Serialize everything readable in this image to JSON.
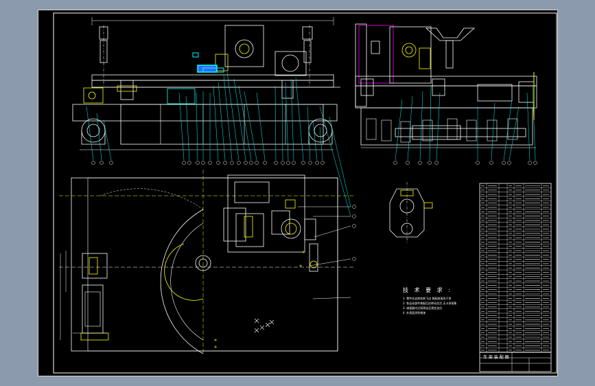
{
  "drawing": {
    "background": "#8c9aae",
    "sheet_color": "#000000",
    "line_colors": {
      "white": "#ffffff",
      "yellow": "#ffff00",
      "cyan": "#00ffff",
      "blue": "#2f6bff",
      "magenta": "#ff00ff",
      "green": "#00ff00",
      "red": "#ff3030"
    },
    "technical_requirements": {
      "title": "技 术 要 求 :",
      "lines": [
        "1. 零件应去除毛刺飞边 装配前清洗干净",
        "2. 各运动部件装配后应转动灵活 无卡滞现象",
        "3. 减速器内注润滑油至规定油位",
        "4. 外表面涂防锈漆"
      ]
    },
    "title_block": {
      "name_cell": "车 架 装 配 图",
      "cells": [
        "",
        "",
        ""
      ]
    },
    "icons": {
      "section_marker": "section-arrow-icon",
      "balloon": "part-balloon-icon"
    }
  }
}
